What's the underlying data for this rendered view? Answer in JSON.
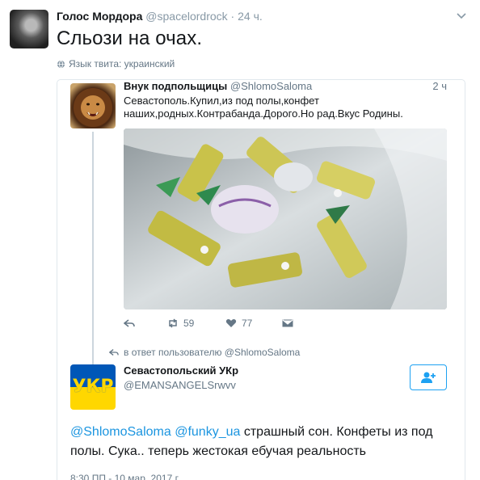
{
  "tweet": {
    "author_name": "Голос Мордора",
    "author_handle": "@spacelordrock",
    "dot": "·",
    "time": "24 ч.",
    "text": "Сльози на очах.",
    "language_label": "Язык твита: украинский"
  },
  "quoted": {
    "author_name": "Внук подпольщицы",
    "author_handle": "@ShlomoSaloma",
    "time": "2 ч",
    "text": "Севастополь.Купил,из под полы,конфет наших,родных.Контрабанда.Дорого.Но рад.Вкус Родины.",
    "retweet_count": "59",
    "like_count": "77"
  },
  "reply": {
    "reply_to_label": "в ответ пользователю @ShlomoSaloma",
    "author_name": "Севастопольский УКр",
    "author_handle": "@EMANSANGELSrwvv",
    "avatar_text": "УКР",
    "mention_1": "@ShlomoSaloma",
    "mention_2": "@funky_ua",
    "text": "страшный сон. Конфеты из под полы. Сука.. теперь жестокая ебучая реальность",
    "timestamp": "8:30 ПП - 10 мар. 2017 г."
  },
  "colors": {
    "link": "#1b95e0",
    "muted": "#657786",
    "border": "#e1e8ed",
    "flag_blue": "#0057b7",
    "flag_yellow": "#ffd700"
  },
  "icons": [
    "caret-down-icon",
    "globe-icon",
    "reply-icon",
    "retweet-icon",
    "heart-icon",
    "dm-icon",
    "follow-icon"
  ]
}
